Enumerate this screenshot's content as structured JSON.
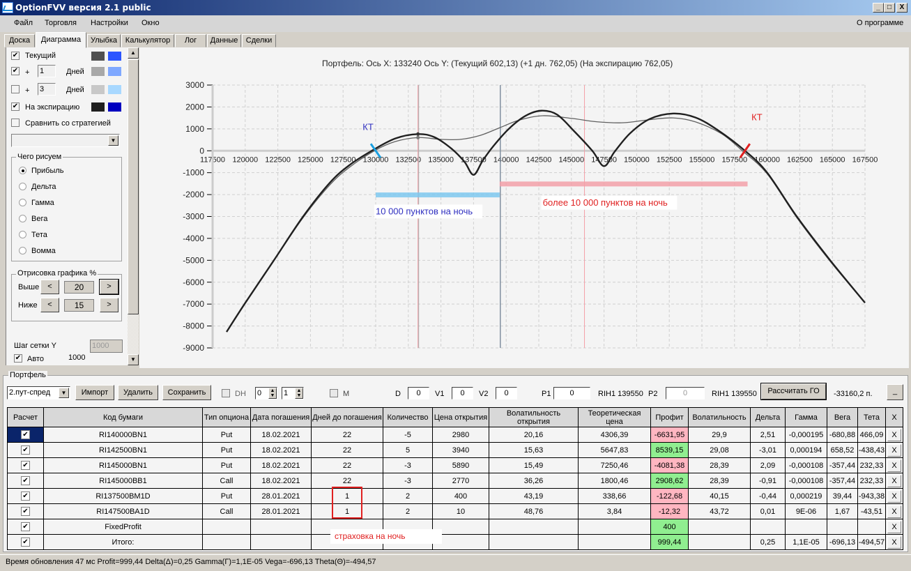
{
  "window": {
    "title": "OptionFVV версия 2.1 public",
    "controls": [
      "_",
      "□",
      "X"
    ]
  },
  "menu": {
    "items": [
      "Файл",
      "Торговля",
      "Настройки",
      "Окно"
    ],
    "about": "О программе"
  },
  "tabs": [
    "Доска",
    "Диаграмма",
    "Улыбка",
    "Калькулятор",
    "Лог",
    "Данные",
    "Сделки"
  ],
  "active_tab": "Диаграмма",
  "left": {
    "curves": [
      {
        "label": "Текущий",
        "checked": true,
        "days": null,
        "color1": "#505050",
        "color2": "#2b55ff"
      },
      {
        "label": "Дней",
        "plus": "+",
        "checked": true,
        "days": "1",
        "color1": "#a8a8a8",
        "color2": "#7fa8ff"
      },
      {
        "label": "Дней",
        "plus": "+",
        "checked": false,
        "days": "3",
        "color1": "#c8c8c8",
        "color2": "#a8d8ff"
      },
      {
        "label": "На экспирацию",
        "checked": true,
        "days": null,
        "color1": "#202020",
        "color2": "#0000c0"
      }
    ],
    "compare_label": "Сравнить со стратегией",
    "draw_group": "Чего рисуем",
    "draw_options": [
      "Прибыль",
      "Дельта",
      "Гамма",
      "Вега",
      "Тета",
      "Вомма"
    ],
    "draw_selected": "Прибыль",
    "render_group": "Отрисовка графика %",
    "above_label": "Выше",
    "above_value": "20",
    "below_label": "Ниже",
    "below_value": "15",
    "grid_step_label": "Шаг сетки Y",
    "grid_step_value": "1000",
    "auto_label": "Авто",
    "auto_value": "1000"
  },
  "chart_info": "Портфель: Ось X: 133240 Ось Y:  (Текущий 602,13)  (+1 дн. 762,05)  (На экспирацию 762,05)",
  "chart_data": {
    "type": "line",
    "xlim": [
      117500,
      167500
    ],
    "ylim": [
      -9000,
      3000
    ],
    "xticks": [
      117500,
      120000,
      122500,
      125000,
      127500,
      130000,
      132500,
      135000,
      137500,
      140000,
      142500,
      145000,
      147500,
      150000,
      152500,
      155000,
      157500,
      160000,
      162500,
      165000,
      167500
    ],
    "yticks": [
      3000,
      2000,
      1000,
      0,
      -1000,
      -2000,
      -3000,
      -4000,
      -5000,
      -6000,
      -7000,
      -8000,
      -9000
    ],
    "grid": true,
    "cursor_x": 133240,
    "current_price_x": 139550,
    "marker_x": 146000,
    "series": [
      {
        "id": "expiration",
        "color": "#202020",
        "points": [
          [
            118570,
            -8270
          ],
          [
            120000,
            -6950
          ],
          [
            122200,
            -5000
          ],
          [
            124440,
            -3000
          ],
          [
            126500,
            -1450
          ],
          [
            128000,
            -650
          ],
          [
            129700,
            0
          ],
          [
            131500,
            560
          ],
          [
            133240,
            762
          ],
          [
            134500,
            620
          ],
          [
            135800,
            100
          ],
          [
            136800,
            -500
          ],
          [
            137500,
            -1100
          ],
          [
            138200,
            -450
          ],
          [
            139000,
            200
          ],
          [
            140200,
            1000
          ],
          [
            141500,
            1600
          ],
          [
            142700,
            1830
          ],
          [
            143900,
            1650
          ],
          [
            145200,
            900
          ],
          [
            146600,
            0
          ],
          [
            147500,
            -700
          ],
          [
            148300,
            -50
          ],
          [
            149500,
            800
          ],
          [
            151000,
            1450
          ],
          [
            152800,
            1700
          ],
          [
            154500,
            1520
          ],
          [
            156200,
            950
          ],
          [
            158300,
            0
          ],
          [
            160000,
            -1000
          ],
          [
            162270,
            -3000
          ],
          [
            164830,
            -5000
          ],
          [
            167500,
            -6940
          ]
        ]
      },
      {
        "id": "current",
        "color": "#606060",
        "points": [
          [
            118570,
            -8270
          ],
          [
            120000,
            -6950
          ],
          [
            122200,
            -5000
          ],
          [
            124440,
            -3050
          ],
          [
            126500,
            -1550
          ],
          [
            128000,
            -750
          ],
          [
            129900,
            0
          ],
          [
            131500,
            420
          ],
          [
            133240,
            602
          ],
          [
            135000,
            520
          ],
          [
            136500,
            520
          ],
          [
            138000,
            700
          ],
          [
            139500,
            1050
          ],
          [
            141000,
            1400
          ],
          [
            142800,
            1600
          ],
          [
            145000,
            1480
          ],
          [
            147000,
            1320
          ],
          [
            149000,
            1280
          ],
          [
            151000,
            1420
          ],
          [
            152800,
            1500
          ],
          [
            154500,
            1320
          ],
          [
            156500,
            780
          ],
          [
            158100,
            0
          ],
          [
            160000,
            -1050
          ],
          [
            162270,
            -3050
          ],
          [
            164830,
            -5050
          ],
          [
            167500,
            -6940
          ]
        ]
      }
    ],
    "bands": [
      {
        "x": [
          130000,
          139500
        ],
        "y": -2000,
        "color": "#7ec8ee"
      },
      {
        "x": [
          139500,
          158500
        ],
        "y": -1500,
        "color": "#f2a0a8"
      }
    ],
    "annotations": [
      {
        "text": "КТ",
        "x": 129000,
        "y": 950,
        "color": "#3030c0"
      },
      {
        "text": "КТ",
        "x": 158800,
        "y": 1400,
        "color": "#e02020"
      },
      {
        "text": "10 000 пунктов на ночь",
        "x": 130000,
        "y": -2900,
        "color": "#3030c0"
      },
      {
        "text": "более 10 000 пунктов на ночь",
        "x": 142800,
        "y": -2500,
        "color": "#e02020"
      }
    ],
    "breakeven_marks": [
      {
        "x": 130000,
        "color": "#1a9fe0"
      },
      {
        "x": 158300,
        "color": "#e02020"
      }
    ]
  },
  "portfolio": {
    "group_label": "Портфель",
    "strategy": "2.пут-спред",
    "import": "Импорт",
    "delete": "Удалить",
    "save": "Сохранить",
    "dh_label": "DH",
    "spin1": "0",
    "spin2": "1",
    "m_label": "M",
    "d_label": "D",
    "d_value": "0",
    "v1_label": "V1",
    "v1_value": "0",
    "v2_label": "V2",
    "v2_value": "0",
    "p1_label": "P1",
    "p1_value": "0",
    "p1_ticker": "RIH1 139550",
    "p2_label": "P2",
    "p2_value": "0",
    "p2_ticker": "RIH1 139550",
    "calc_go": "Рассчитать ГО",
    "go_value": "-33160,2 п.",
    "minimize": "_",
    "columns": [
      "Расчет",
      "Код бумаги",
      "Тип опциона",
      "Дата погашения",
      "Дней до погашения",
      "Количество",
      "Цена открытия",
      "Волатильность открытия",
      "Теоретическая цена",
      "Профит",
      "Волатильность",
      "Дельта",
      "Гамма",
      "Вега",
      "Тета",
      "X"
    ],
    "rows": [
      [
        "RI140000BN1",
        "Put",
        "18.02.2021",
        "22",
        "-5",
        "2980",
        "20,16",
        "4306,39",
        "-6631,95",
        "29,9",
        "2,51",
        "-0,000195",
        "-680,88",
        "466,09"
      ],
      [
        "RI142500BN1",
        "Put",
        "18.02.2021",
        "22",
        "5",
        "3940",
        "15,63",
        "5647,83",
        "8539,15",
        "29,08",
        "-3,01",
        "0,000194",
        "658,52",
        "-438,43"
      ],
      [
        "RI145000BN1",
        "Put",
        "18.02.2021",
        "22",
        "-3",
        "5890",
        "15,49",
        "7250,46",
        "-4081,38",
        "28,39",
        "2,09",
        "-0,000108",
        "-357,44",
        "232,33"
      ],
      [
        "RI145000BB1",
        "Call",
        "18.02.2021",
        "22",
        "-3",
        "2770",
        "36,26",
        "1800,46",
        "2908,62",
        "28,39",
        "-0,91",
        "-0,000108",
        "-357,44",
        "232,33"
      ],
      [
        "RI137500BM1D",
        "Put",
        "28.01.2021",
        "1",
        "2",
        "400",
        "43,19",
        "338,66",
        "-122,68",
        "40,15",
        "-0,44",
        "0,000219",
        "39,44",
        "-943,38"
      ],
      [
        "RI147500BA1D",
        "Call",
        "28.01.2021",
        "1",
        "2",
        "10",
        "48,76",
        "3,84",
        "-12,32",
        "43,72",
        "0,01",
        "9E-06",
        "1,67",
        "-43,51"
      ],
      [
        "FixedProfit",
        "",
        "",
        "",
        "",
        "",
        "",
        "",
        "400",
        "",
        "",
        "",
        "",
        ""
      ],
      [
        "Итого:",
        "",
        "",
        "",
        "",
        "",
        "",
        "",
        "999,44",
        "",
        "0,25",
        "1,1E-05",
        "-696,13",
        "-494,57"
      ]
    ],
    "delete_label": "X",
    "note": "страховка на ночь"
  },
  "status": "Время обновления 47 мс  Profit=999,44 Delta(Δ)=0,25 Gamma(Γ)=1,1E-05 Vega=-696,13 Theta(Θ)=-494,57"
}
